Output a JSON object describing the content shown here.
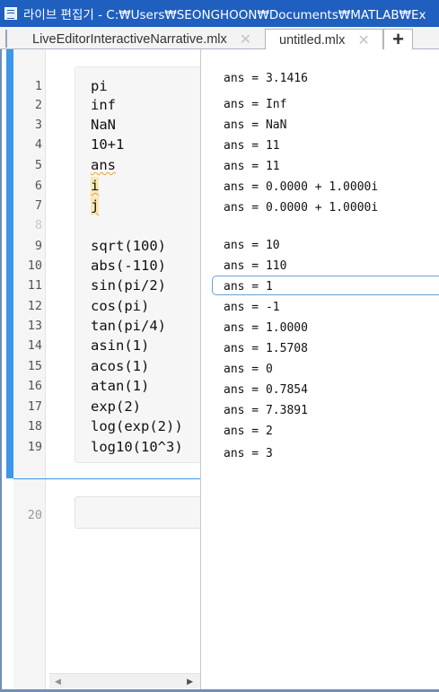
{
  "window": {
    "title": "라이브 편집기 - C:₩Users₩SEONGHOON₩Documents₩MATLAB₩Ex"
  },
  "tabs": [
    {
      "label": "LiveEditorInteractiveNarrative.mlx",
      "close": "✕",
      "active": false
    },
    {
      "label": "untitled.mlx",
      "close": "✕",
      "active": true
    }
  ],
  "add_tab_label": "+",
  "line_numbers": [
    "1",
    "2",
    "3",
    "4",
    "5",
    "6",
    "7",
    "8",
    "9",
    "10",
    "11",
    "12",
    "13",
    "14",
    "15",
    "16",
    "17",
    "18",
    "19",
    "20"
  ],
  "code": {
    "lines": [
      "pi",
      "inf",
      "NaN",
      "10+1",
      "ans",
      "i",
      "j",
      "",
      "sqrt(100)",
      "abs(-110)",
      "sin(pi/2)",
      "cos(pi)",
      "tan(pi/4)",
      "asin(1)",
      "acos(1)",
      "atan(1)",
      "exp(2)",
      "log(exp(2))",
      "log10(10^3)"
    ]
  },
  "outputs": [
    "ans = 3.1416",
    "ans = Inf",
    "ans = NaN",
    "ans = 11",
    "ans = 11",
    "ans = 0.0000 + 1.0000i",
    "ans = 0.0000 + 1.0000i",
    "ans = 10",
    "ans = 110",
    "ans = 1",
    "ans = -1",
    "ans = 1.0000",
    "ans = 1.5708",
    "ans = 0",
    "ans = 0.7854",
    "ans = 7.3891",
    "ans = 2",
    "ans = 3"
  ],
  "scrollbar": {
    "left_arrow": "◀",
    "right_arrow": "▶"
  },
  "colors": {
    "titlebar": "#1f5fbf",
    "section_bar": "#3c97ea",
    "selection_border": "#6a9fd8",
    "warning_underline": "#e6a23c",
    "highlight": "#fde7b0"
  }
}
